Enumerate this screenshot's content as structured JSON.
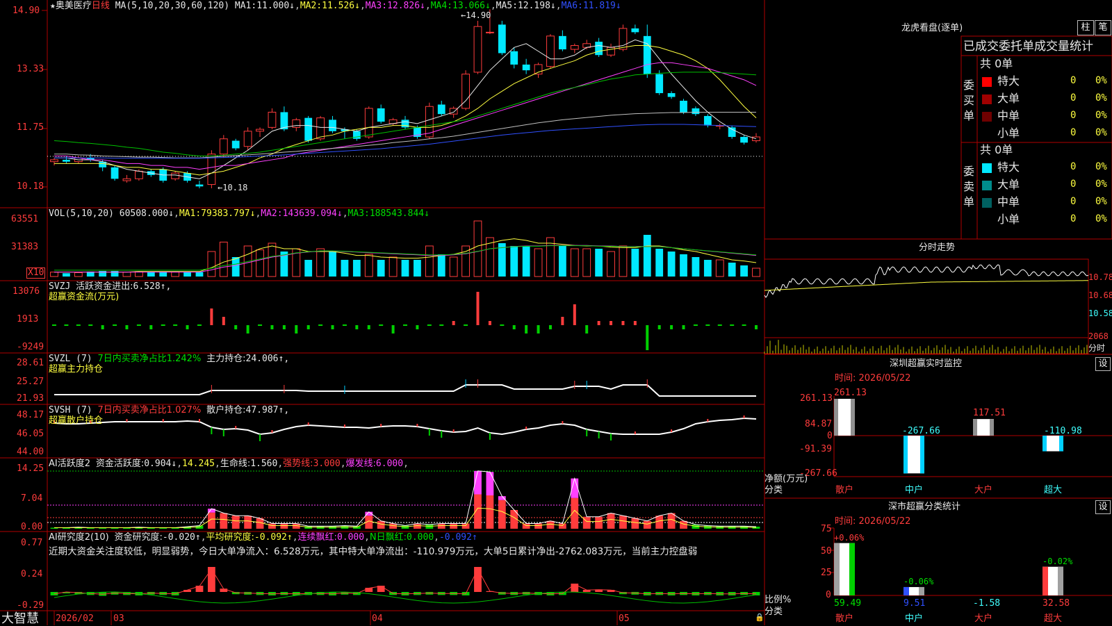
{
  "colors": {
    "up": "#ff3c3c",
    "down": "#00e8ff",
    "grid": "#b00000",
    "ma1": "#e8e8e8",
    "ma2": "#ffff40",
    "ma3": "#ff40ff",
    "ma4": "#00c000",
    "ma5": "#c0c0c0",
    "ma6": "#3050ff"
  },
  "main": {
    "star": "★",
    "stock": "奥美医疗",
    "period": "日线",
    "ma_label": "MA(5,10,20,30,60,120)",
    "ma": [
      {
        "k": "MA1:",
        "v": "11.000↓"
      },
      {
        "k": "MA2:",
        "v": "11.526↓"
      },
      {
        "k": "MA3:",
        "v": "12.826↓"
      },
      {
        "k": "MA4:",
        "v": "13.066↓"
      },
      {
        "k": "MA5:",
        "v": "12.198↓"
      },
      {
        "k": "MA6:",
        "v": "11.819↓"
      }
    ],
    "axis": [
      "14.90",
      "13.33",
      "11.75",
      "10.18"
    ],
    "high_mark": "←14.90",
    "low_mark": "←10.18",
    "candles": [
      [
        10.9,
        10.95,
        10.8,
        11.0
      ],
      [
        10.95,
        10.9,
        10.85,
        11.05
      ],
      [
        10.9,
        11.0,
        10.85,
        11.05
      ],
      [
        11.0,
        10.95,
        10.9,
        11.1
      ],
      [
        10.9,
        10.75,
        10.65,
        10.95
      ],
      [
        10.75,
        10.45,
        10.4,
        10.8
      ],
      [
        10.4,
        10.45,
        10.35,
        10.55
      ],
      [
        10.45,
        10.65,
        10.4,
        10.7
      ],
      [
        10.65,
        10.55,
        10.5,
        10.7
      ],
      [
        10.7,
        10.4,
        10.35,
        10.75
      ],
      [
        10.45,
        10.6,
        10.4,
        10.65
      ],
      [
        10.6,
        10.4,
        10.35,
        10.65
      ],
      [
        10.3,
        10.25,
        10.2,
        10.4
      ],
      [
        10.3,
        11.1,
        10.2,
        11.2
      ],
      [
        11.1,
        11.5,
        11.0,
        11.6
      ],
      [
        11.45,
        11.25,
        11.2,
        11.5
      ],
      [
        11.3,
        11.7,
        11.2,
        11.8
      ],
      [
        11.7,
        11.75,
        11.55,
        11.8
      ],
      [
        11.8,
        12.2,
        11.75,
        12.3
      ],
      [
        12.2,
        11.75,
        11.7,
        12.35
      ],
      [
        11.8,
        12.0,
        11.7,
        12.05
      ],
      [
        12.05,
        11.45,
        11.4,
        12.1
      ],
      [
        11.5,
        12.05,
        11.45,
        12.1
      ],
      [
        12.0,
        11.7,
        11.65,
        12.1
      ],
      [
        11.75,
        11.7,
        11.5,
        11.8
      ],
      [
        11.7,
        11.5,
        11.45,
        11.75
      ],
      [
        11.55,
        12.3,
        11.5,
        12.35
      ],
      [
        12.3,
        11.95,
        11.9,
        12.4
      ],
      [
        11.9,
        12.0,
        11.85,
        12.05
      ],
      [
        12.0,
        11.8,
        11.75,
        12.1
      ],
      [
        11.8,
        11.55,
        11.5,
        11.85
      ],
      [
        11.55,
        12.35,
        11.5,
        12.45
      ],
      [
        12.4,
        12.15,
        12.1,
        12.5
      ],
      [
        12.15,
        12.3,
        12.05,
        12.35
      ],
      [
        12.3,
        13.2,
        12.25,
        13.3
      ],
      [
        13.25,
        14.45,
        13.2,
        14.6
      ],
      [
        14.3,
        14.3,
        14.25,
        14.9
      ],
      [
        14.5,
        13.75,
        13.7,
        14.6
      ],
      [
        13.8,
        13.45,
        13.35,
        13.9
      ],
      [
        13.45,
        13.3,
        13.2,
        13.6
      ],
      [
        13.2,
        13.45,
        13.1,
        13.5
      ],
      [
        13.4,
        14.2,
        13.35,
        14.25
      ],
      [
        14.2,
        13.85,
        13.8,
        14.35
      ],
      [
        13.85,
        13.95,
        13.75,
        14.0
      ],
      [
        13.9,
        14.0,
        13.85,
        14.1
      ],
      [
        14.05,
        13.7,
        13.65,
        14.15
      ],
      [
        13.7,
        13.9,
        13.65,
        14.0
      ],
      [
        13.85,
        14.4,
        13.8,
        14.5
      ],
      [
        14.4,
        14.3,
        14.25,
        14.5
      ],
      [
        14.2,
        13.2,
        13.1,
        14.5
      ],
      [
        13.2,
        12.7,
        12.65,
        13.3
      ],
      [
        12.7,
        12.6,
        12.55,
        12.75
      ],
      [
        12.5,
        12.2,
        12.15,
        12.55
      ],
      [
        12.3,
        12.15,
        12.1,
        12.35
      ],
      [
        12.1,
        11.85,
        11.8,
        12.15
      ],
      [
        11.85,
        11.85,
        11.75,
        11.9
      ],
      [
        11.8,
        11.55,
        11.5,
        11.85
      ],
      [
        11.55,
        11.4,
        11.35,
        11.6
      ],
      [
        11.45,
        11.55,
        11.4,
        11.65
      ]
    ],
    "ma_lines": {
      "ma1": [
        11.0,
        11.0,
        10.95,
        10.95,
        10.9,
        10.8,
        10.7,
        10.65,
        10.6,
        10.55,
        10.55,
        10.5,
        10.45,
        10.6,
        10.8,
        11.0,
        11.2,
        11.45,
        11.7,
        11.8,
        11.85,
        11.85,
        11.8,
        11.8,
        11.75,
        11.7,
        11.8,
        11.85,
        11.9,
        11.95,
        11.9,
        12.0,
        12.1,
        12.2,
        12.5,
        12.9,
        13.3,
        13.6,
        13.9,
        14.0,
        13.8,
        13.6,
        13.6,
        13.7,
        13.9,
        13.95,
        13.9,
        13.95,
        14.1,
        14.0,
        13.6,
        13.2,
        12.85,
        12.5,
        12.2,
        11.95,
        11.75,
        11.6,
        11.5
      ],
      "ma2": [
        10.85,
        10.85,
        10.85,
        10.85,
        10.85,
        10.8,
        10.75,
        10.75,
        10.7,
        10.7,
        10.65,
        10.6,
        10.55,
        10.6,
        10.65,
        10.75,
        10.85,
        11.0,
        11.1,
        11.25,
        11.35,
        11.45,
        11.55,
        11.6,
        11.7,
        11.75,
        11.8,
        11.8,
        11.85,
        11.85,
        11.8,
        11.8,
        11.85,
        11.95,
        12.1,
        12.3,
        12.55,
        12.75,
        12.95,
        13.1,
        13.25,
        13.35,
        13.45,
        13.55,
        13.7,
        13.8,
        13.85,
        13.9,
        13.95,
        13.95,
        13.9,
        13.8,
        13.7,
        13.55,
        13.35,
        13.05,
        12.7,
        12.35,
        12.05
      ],
      "ma3": [
        11.05,
        11.05,
        11.0,
        10.95,
        10.95,
        10.9,
        10.85,
        10.85,
        10.8,
        10.8,
        10.75,
        10.75,
        10.7,
        10.75,
        10.8,
        10.8,
        10.85,
        10.9,
        10.95,
        11.0,
        11.1,
        11.15,
        11.2,
        11.25,
        11.3,
        11.35,
        11.4,
        11.45,
        11.5,
        11.55,
        11.6,
        11.65,
        11.75,
        11.85,
        11.95,
        12.05,
        12.15,
        12.25,
        12.35,
        12.45,
        12.55,
        12.65,
        12.75,
        12.85,
        12.95,
        13.05,
        13.15,
        13.25,
        13.35,
        13.45,
        13.5,
        13.5,
        13.45,
        13.4,
        13.35,
        13.25,
        13.15,
        13.05,
        12.9
      ],
      "ma4": [
        11.45,
        11.43,
        11.4,
        11.38,
        11.35,
        11.32,
        11.28,
        11.25,
        11.2,
        11.15,
        11.12,
        11.08,
        11.05,
        11.05,
        11.07,
        11.1,
        11.12,
        11.15,
        11.2,
        11.25,
        11.3,
        11.35,
        11.4,
        11.45,
        11.5,
        11.55,
        11.6,
        11.65,
        11.7,
        11.75,
        11.8,
        11.85,
        11.9,
        11.95,
        12.0,
        12.1,
        12.2,
        12.3,
        12.4,
        12.5,
        12.6,
        12.7,
        12.78,
        12.85,
        12.92,
        13.0,
        13.07,
        13.12,
        13.18,
        13.2,
        13.22,
        13.24,
        13.25,
        13.25,
        13.25,
        13.24,
        13.22,
        13.2,
        13.18
      ],
      "ma5": [
        11.1,
        11.1,
        11.08,
        11.07,
        11.05,
        11.04,
        11.03,
        11.02,
        11.02,
        11.01,
        11.0,
        11.0,
        11.0,
        11.02,
        11.04,
        11.06,
        11.08,
        11.1,
        11.12,
        11.15,
        11.17,
        11.2,
        11.22,
        11.25,
        11.27,
        11.3,
        11.33,
        11.36,
        11.4,
        11.43,
        11.46,
        11.5,
        11.53,
        11.57,
        11.62,
        11.67,
        11.72,
        11.77,
        11.82,
        11.87,
        11.92,
        11.96,
        12.0,
        12.03,
        12.06,
        12.09,
        12.12,
        12.14,
        12.16,
        12.17,
        12.18,
        12.19,
        12.19,
        12.2,
        12.2,
        12.2,
        12.2,
        12.2,
        12.2
      ],
      "ma6": [
        11.0,
        11.0,
        11.0,
        11.0,
        11.0,
        10.99,
        10.99,
        10.99,
        10.99,
        10.99,
        10.99,
        10.99,
        10.99,
        11.0,
        11.01,
        11.02,
        11.03,
        11.05,
        11.06,
        11.08,
        11.1,
        11.12,
        11.14,
        11.16,
        11.18,
        11.2,
        11.22,
        11.24,
        11.27,
        11.3,
        11.33,
        11.36,
        11.4,
        11.44,
        11.48,
        11.52,
        11.56,
        11.6,
        11.63,
        11.66,
        11.69,
        11.72,
        11.74,
        11.76,
        11.78,
        11.8,
        11.82,
        11.84,
        11.86,
        11.87,
        11.88,
        11.88,
        11.88,
        11.87,
        11.86,
        11.85,
        11.84,
        11.83,
        11.82
      ]
    }
  },
  "vol": {
    "title": "VOL(5,10,20)",
    "v0": "60508.000↓",
    "ma": [
      {
        "k": "MA1:",
        "v": "79383.797↓"
      },
      {
        "k": "MA2:",
        "v": "143639.094↓"
      },
      {
        "k": "MA3:",
        "v": "188543.844↓"
      }
    ],
    "axis": [
      "63551",
      "31383"
    ],
    "unit": "X10",
    "bars": [
      0.08,
      0.06,
      0.07,
      0.09,
      0.1,
      0.1,
      0.08,
      0.09,
      0.08,
      0.09,
      0.08,
      0.08,
      0.08,
      0.45,
      0.62,
      0.35,
      0.55,
      0.48,
      0.6,
      0.45,
      0.5,
      0.3,
      0.5,
      0.45,
      0.3,
      0.3,
      0.4,
      0.3,
      0.35,
      0.3,
      0.3,
      0.55,
      0.4,
      0.35,
      0.55,
      1.0,
      0.7,
      0.6,
      0.55,
      0.55,
      0.5,
      0.7,
      0.55,
      0.5,
      0.5,
      0.5,
      0.45,
      0.55,
      0.5,
      0.75,
      0.5,
      0.45,
      0.4,
      0.35,
      0.3,
      0.3,
      0.25,
      0.2,
      0.15
    ],
    "ma1": [
      0.08,
      0.08,
      0.08,
      0.08,
      0.08,
      0.08,
      0.08,
      0.09,
      0.09,
      0.09,
      0.09,
      0.09,
      0.09,
      0.16,
      0.26,
      0.32,
      0.4,
      0.5,
      0.55,
      0.5,
      0.5,
      0.45,
      0.45,
      0.45,
      0.42,
      0.38,
      0.38,
      0.35,
      0.34,
      0.33,
      0.33,
      0.35,
      0.38,
      0.4,
      0.45,
      0.55,
      0.6,
      0.65,
      0.68,
      0.65,
      0.6,
      0.6,
      0.58,
      0.56,
      0.55,
      0.55,
      0.53,
      0.52,
      0.52,
      0.55,
      0.55,
      0.52,
      0.48,
      0.45,
      0.4,
      0.35,
      0.3,
      0.28,
      0.25
    ],
    "ma2": [
      0.08,
      0.08,
      0.08,
      0.08,
      0.08,
      0.08,
      0.08,
      0.08,
      0.08,
      0.08,
      0.08,
      0.08,
      0.08,
      0.12,
      0.17,
      0.2,
      0.25,
      0.3,
      0.35,
      0.38,
      0.42,
      0.44,
      0.46,
      0.46,
      0.45,
      0.44,
      0.43,
      0.42,
      0.41,
      0.4,
      0.39,
      0.38,
      0.38,
      0.39,
      0.41,
      0.45,
      0.5,
      0.52,
      0.54,
      0.55,
      0.55,
      0.56,
      0.56,
      0.56,
      0.56,
      0.55,
      0.55,
      0.54,
      0.54,
      0.54,
      0.54,
      0.52,
      0.5,
      0.48,
      0.46,
      0.44,
      0.42,
      0.4,
      0.38
    ]
  },
  "svzj": {
    "title": "SVZJ",
    "label1": "活跃资金进出:",
    "v1": "6.528↑",
    "comma": ",",
    "label2": "超赢资金流(万元)",
    "axis": [
      "13076",
      "1913",
      "-9249"
    ],
    "bars": [
      0,
      0,
      0,
      0,
      -1,
      0,
      -1,
      0,
      -1,
      0,
      0,
      -1,
      0,
      4,
      2,
      -1,
      -2,
      0,
      -1,
      -1,
      -2,
      -1,
      0,
      -1,
      0,
      -1,
      -1,
      0,
      -2,
      0,
      -1,
      0,
      0,
      1,
      0,
      8,
      1,
      0,
      -1,
      -2,
      -2,
      -1,
      2,
      5,
      -2,
      1,
      1,
      1,
      1,
      -6,
      -1,
      -1,
      -1,
      0,
      0,
      0,
      0,
      0,
      -1
    ]
  },
  "svzl": {
    "title": "SVZL (7)",
    "label1": "7日内买卖净占比1.242%",
    "label2": "主力持仓:",
    "v2": "24.006↑",
    "comma": ",",
    "label3": "超赢主力持仓",
    "axis": [
      "28.61",
      "25.27",
      "21.93"
    ]
  },
  "svsh": {
    "title": "SVSH (7)",
    "label1": "7日内买卖净占比1.027%",
    "label2": "散户持仓:",
    "v2": "47.987↑",
    "comma": ",",
    "label3": "超赢散户持仓",
    "axis": [
      "48.17",
      "46.05",
      "44.00"
    ]
  },
  "ai1": {
    "title": "AI活跃度2",
    "items": [
      {
        "t": "资金活跃度:",
        "v": "0.904↓"
      },
      {
        "t": "14.245",
        "v": ""
      },
      {
        "t": "生命线:",
        "v": "1.560"
      },
      {
        "t": "强势线:",
        "v": "3.000"
      },
      {
        "t": "爆发线:",
        "v": "6.000"
      }
    ],
    "axis": [
      "14.25",
      "7.04",
      "0.00"
    ],
    "bars": [
      0.2,
      0.2,
      0.3,
      0.2,
      0.2,
      0.2,
      0.2,
      0.3,
      0.2,
      0.2,
      0.2,
      0.4,
      0.6,
      3.1,
      3.0,
      2.5,
      2.5,
      2.0,
      1.0,
      1.0,
      1.0,
      0.5,
      0.5,
      0.5,
      0.6,
      0.5,
      2.5,
      1.5,
      1.0,
      0.6,
      1.0,
      0.8,
      1.0,
      1.0,
      1.0,
      6.6,
      6.4,
      5.5,
      3.6,
      1.0,
      1.0,
      1.5,
      1.0,
      5.9,
      2.3,
      2.3,
      3.0,
      2.5,
      2.0,
      1.5,
      2.5,
      3.0,
      1.5,
      0.8,
      0.6,
      0.5,
      0.5,
      0.5,
      0.4
    ],
    "mag": [
      0,
      0,
      0,
      0,
      0,
      0,
      0,
      0,
      0,
      0,
      0,
      0,
      0,
      0.5,
      0,
      0,
      0,
      0,
      0,
      0,
      0,
      0,
      0,
      0,
      0,
      0,
      0.5,
      0,
      0,
      0,
      0,
      0,
      0,
      0,
      0,
      3.0,
      3.0,
      0.5,
      0,
      0,
      0,
      0,
      0,
      2.5,
      0,
      0,
      0,
      0,
      0,
      0,
      0,
      0,
      0,
      0,
      0,
      0,
      0,
      0,
      0
    ]
  },
  "ai2": {
    "title": "AI研究度2(10)",
    "items": [
      {
        "t": "资金研究度:",
        "v": "-0.020↑"
      },
      {
        "t": "平均研究度:",
        "v": "-0.092↑"
      },
      {
        "t": "连续飘红:",
        "v": "0.000"
      },
      {
        "t": "N日飘红:",
        "v": "0.000"
      },
      {
        "t": "",
        "v": "-0.092↑"
      }
    ],
    "comment": "近期大资金关注度较低，明显弱势，今日大单净流入：6.528万元，其中特大单净流出：-110.979万元，大单5日累计净出-2762.083万元，当前主力控盘弱",
    "axis": [
      "0.77",
      "0.24",
      "-0.29"
    ],
    "bars": [
      -0.05,
      0,
      -0.02,
      -0.04,
      -0.06,
      -0.03,
      -0.04,
      -0.05,
      -0.03,
      -0.04,
      -0.05,
      0.05,
      0.15,
      0.6,
      0.08,
      -0.02,
      -0.03,
      -0.04,
      -0.05,
      -0.04,
      -0.05,
      -0.04,
      -0.04,
      -0.05,
      -0.03,
      -0.04,
      0.1,
      0.15,
      -0.04,
      -0.05,
      -0.04,
      -0.03,
      -0.04,
      -0.04,
      -0.05,
      0.6,
      0.02,
      -0.03,
      -0.04,
      -0.03,
      -0.04,
      -0.05,
      -0.04,
      0.2,
      0.05,
      0.06,
      0.05,
      -0.02,
      -0.03,
      -0.05,
      -0.04,
      -0.05,
      -0.04,
      -0.05,
      -0.04,
      -0.05,
      -0.05,
      -0.04,
      -0.05
    ]
  },
  "dates": {
    "d1": "2026/02",
    "d2": "03",
    "d3": "04",
    "d4": "05"
  },
  "brand": "大智慧",
  "right": {
    "lhkp": "龙虎看盘(逐单)",
    "btn1": "柱",
    "btn2": "笔",
    "stat_title": "已成交委托单成交量统计",
    "buy": {
      "side": "委买单",
      "total": "共 0单",
      "rows": [
        {
          "n": "特大",
          "v": "0",
          "p": "0%",
          "c": "#ff0000"
        },
        {
          "n": "大单",
          "v": "0",
          "p": "0%",
          "c": "#a00000"
        },
        {
          "n": "中单",
          "v": "0",
          "p": "0%",
          "c": "#700000"
        },
        {
          "n": "小单",
          "v": "0",
          "p": "0%",
          "c": "#000"
        }
      ]
    },
    "sell": {
      "side": "委卖单",
      "total": "共 0单",
      "rows": [
        {
          "n": "特大",
          "v": "0",
          "p": "0%",
          "c": "#00e8ff"
        },
        {
          "n": "大单",
          "v": "0",
          "p": "0%",
          "c": "#008c8c"
        },
        {
          "n": "中单",
          "v": "0",
          "p": "0%",
          "c": "#006060"
        },
        {
          "n": "小单",
          "v": "0",
          "p": "0%",
          "c": "#000"
        }
      ]
    },
    "fs": {
      "title": "分时走势",
      "p1": "10.78",
      "p2": "10.68",
      "p3": "10.58",
      "v1": "2068",
      "vunit": "分时"
    },
    "mon1": {
      "title": "深圳超赢实时监控",
      "btn": "设",
      "time": "时间: 2026/05/22",
      "axis": [
        "261.13",
        "84.87",
        "0",
        "-91.39",
        "-267.66"
      ],
      "ylabel": "净额(万元)",
      "xlabel": "分类",
      "cats": [
        {
          "n": "散户",
          "v": "261.13"
        },
        {
          "n": "中户",
          "v": "-267.66"
        },
        {
          "n": "大户",
          "v": "117.51"
        },
        {
          "n": "超大",
          "v": "-110.98"
        }
      ]
    },
    "mon2": {
      "title": "深市超赢分类统计",
      "btn": "设",
      "time": "时间: 2026/05/22",
      "axis": [
        "75",
        "50",
        "25",
        "0"
      ],
      "ylabel": "比例%",
      "xlabel": "分类",
      "cats": [
        {
          "n": "散户",
          "top": "+0.06%",
          "v": "59.49"
        },
        {
          "n": "中户",
          "top": "-0.06%",
          "v": "9.51"
        },
        {
          "n": "大户",
          "top": "",
          "v": "-1.58"
        },
        {
          "n": "超大",
          "top": "-0.02%",
          "v": "32.58"
        }
      ]
    }
  }
}
